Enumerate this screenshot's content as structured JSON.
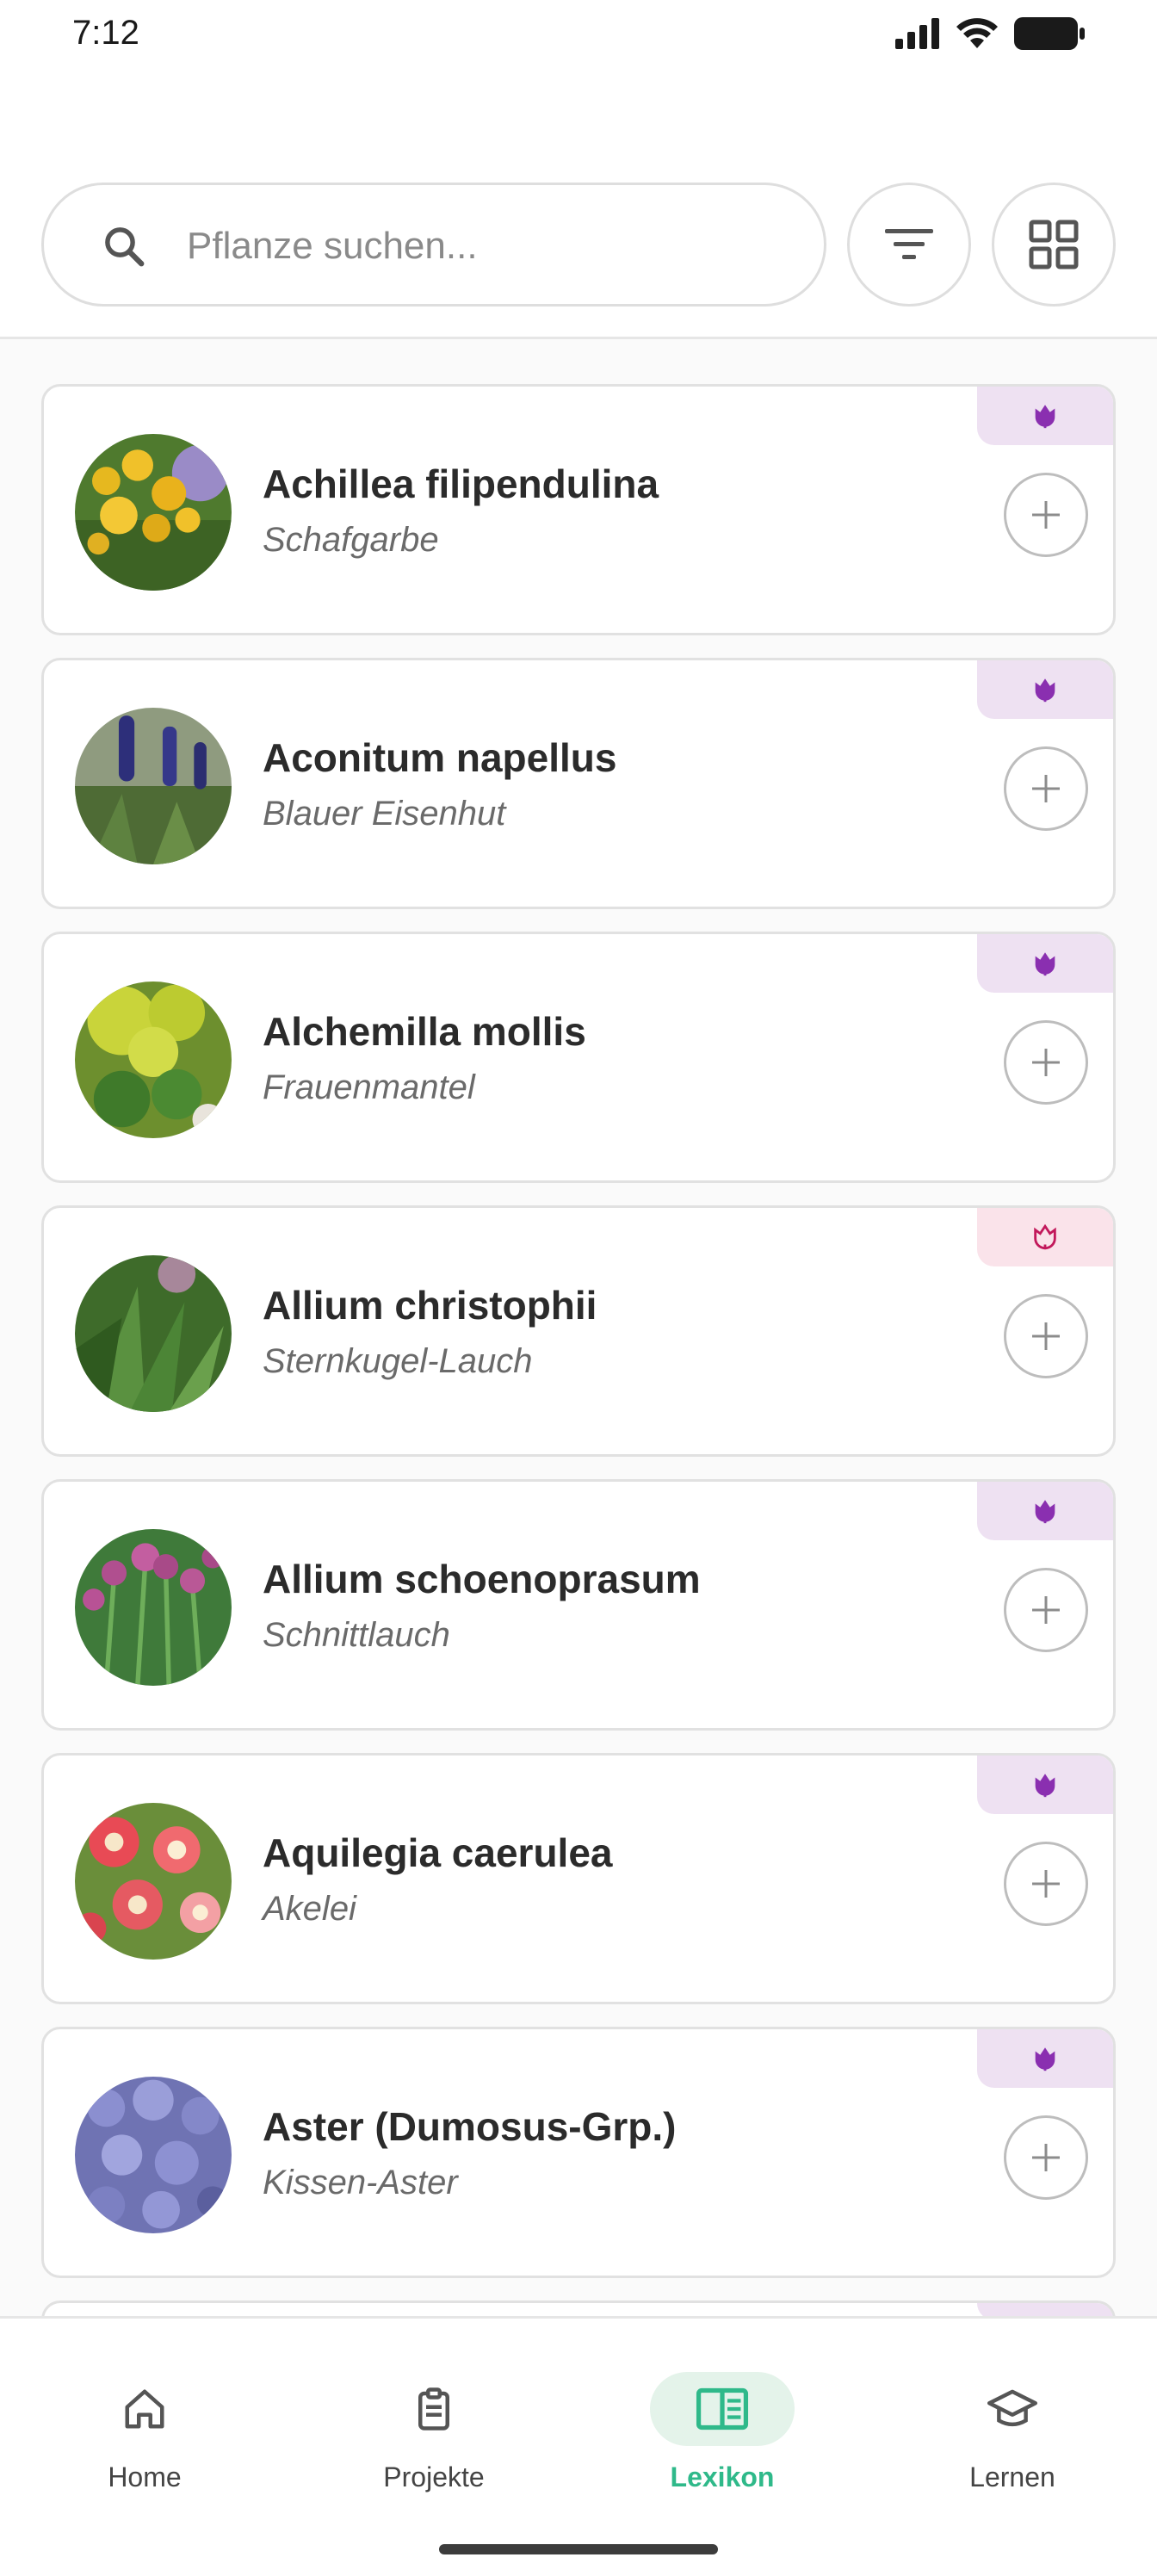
{
  "status": {
    "time": "7:12"
  },
  "search": {
    "placeholder": "Pflanze suchen..."
  },
  "plants": [
    {
      "latin": "Achillea filipendulina",
      "common": "Schafgarbe",
      "type": "perennial"
    },
    {
      "latin": "Aconitum napellus",
      "common": "Blauer Eisenhut",
      "type": "perennial"
    },
    {
      "latin": "Alchemilla mollis",
      "common": "Frauenmantel",
      "type": "perennial"
    },
    {
      "latin": "Allium christophii",
      "common": "Sternkugel-Lauch",
      "type": "bulb"
    },
    {
      "latin": "Allium schoenoprasum",
      "common": "Schnittlauch",
      "type": "perennial"
    },
    {
      "latin": "Aquilegia caerulea",
      "common": "Akelei",
      "type": "perennial"
    },
    {
      "latin": "Aster (Dumosus-Grp.)",
      "common": "Kissen-Aster",
      "type": "perennial"
    }
  ],
  "nav": {
    "home": "Home",
    "projects": "Projekte",
    "lexicon": "Lexikon",
    "learn": "Lernen",
    "active": "lexicon"
  },
  "colors": {
    "accent": "#2fb98a",
    "perennial_badge_bg": "#eee1f2",
    "perennial_icon": "#8a2fb0",
    "bulb_badge_bg": "#fae3ea",
    "bulb_icon": "#c2185b"
  }
}
